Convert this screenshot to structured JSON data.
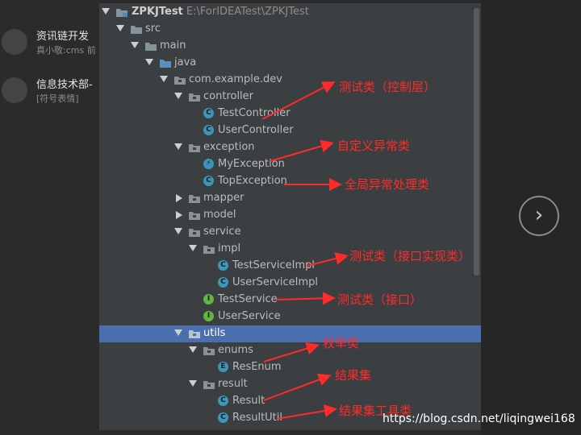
{
  "background_chats": [
    {
      "name": "资讯链开发",
      "sub": "真小敬:cms 前"
    },
    {
      "name": "信息技术部-",
      "sub": "[符号表情]"
    }
  ],
  "project": {
    "name": "ZPKJTest",
    "path": "E:\\ForIDEATest\\ZPKJTest"
  },
  "tree": {
    "src": "src",
    "main": "main",
    "java": "java",
    "package": "com.example.dev",
    "controller": "controller",
    "TestController": "TestController",
    "UserController": "UserController",
    "exception": "exception",
    "MyException": "MyException",
    "TopException": "TopException",
    "mapper": "mapper",
    "model": "model",
    "service": "service",
    "impl": "impl",
    "TestServiceImpl": "TestServiceImpl",
    "UserServiceImpl": "UserServiceImpl",
    "TestService": "TestService",
    "UserService": "UserService",
    "utils": "utils",
    "enums": "enums",
    "ResEnum": "ResEnum",
    "result": "result",
    "Result": "Result",
    "ResultUtil": "ResultUtil"
  },
  "annotations": {
    "controller": "测试类（控制层）",
    "exception": "自定义异常类",
    "global_exception": "全局异常处理类",
    "impl": "测试类（接口实现类）",
    "interface": "测试类（接口）",
    "enums": "枚举类",
    "result": "结果集",
    "result_util": "结果集工具类"
  },
  "watermark": "https://blog.csdn.net/liqingwei168",
  "colors": {
    "panel": "#3c3f41",
    "selection": "#4b6eaf",
    "annotation": "#ff2a2a",
    "class_icon": "#3d96ba",
    "interface_icon": "#62b543"
  }
}
